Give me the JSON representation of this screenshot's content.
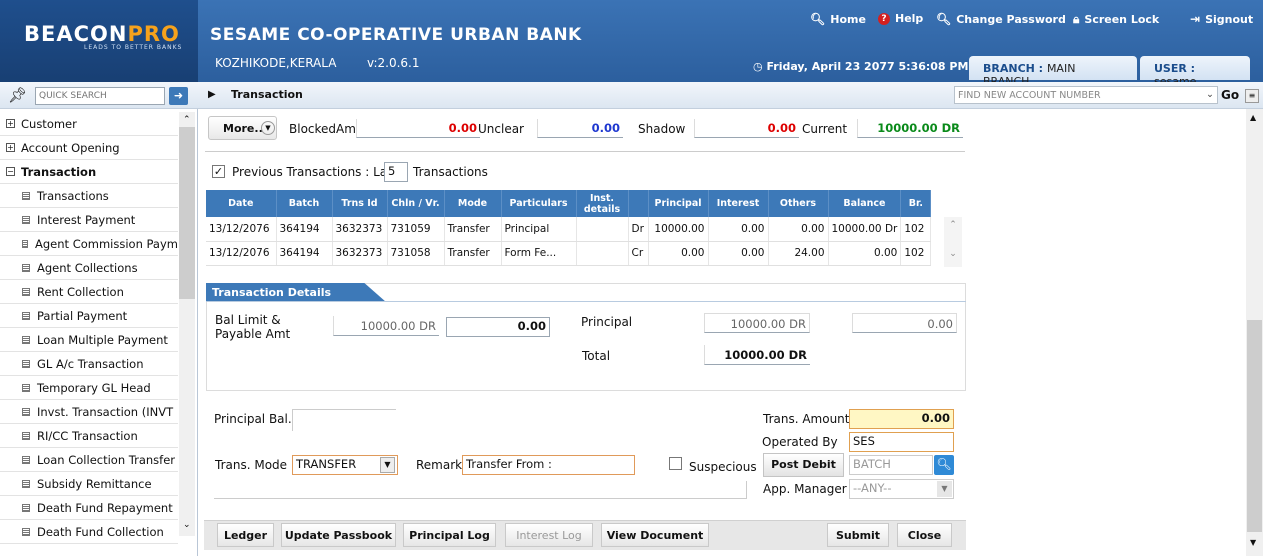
{
  "app": {
    "logo": "BEACONPRO",
    "tagline": "LEADS TO BETTER BANKS",
    "bank_name": "SESAME CO-OPERATIVE URBAN BANK",
    "location": "KOZHIKODE,KERALA",
    "version": "v:2.0.6.1",
    "datetime": "Friday, April 23 2077 5:36:08 PM"
  },
  "toplinks": {
    "home": "Home",
    "help": "Help",
    "change_password": "Change Password",
    "screen_lock": "Screen Lock",
    "signout": "Signout"
  },
  "tabs": {
    "branch_label": "BRANCH :",
    "branch_value": "MAIN BRANCH",
    "user_label": "USER :",
    "user_value": "sesame"
  },
  "search": {
    "placeholder": "QUICK SEARCH",
    "account_placeholder": "FIND NEW ACCOUNT NUMBER",
    "go": "Go"
  },
  "breadcrumb": "Transaction",
  "sidebar": {
    "items": [
      {
        "label": "Customer",
        "type": "top",
        "sign": "+"
      },
      {
        "label": "Account Opening",
        "type": "top",
        "sign": "+"
      },
      {
        "label": "Transaction",
        "type": "top",
        "sign": "−",
        "bold": true
      },
      {
        "label": "Transactions",
        "type": "child"
      },
      {
        "label": "Interest Payment",
        "type": "child"
      },
      {
        "label": "Agent Commission Paym",
        "type": "child"
      },
      {
        "label": "Agent Collections",
        "type": "child"
      },
      {
        "label": "Rent Collection",
        "type": "child"
      },
      {
        "label": "Partial Payment",
        "type": "child"
      },
      {
        "label": "Loan Multiple Payment",
        "type": "child"
      },
      {
        "label": "GL A/c Transaction",
        "type": "child"
      },
      {
        "label": "Temporary GL Head",
        "type": "child"
      },
      {
        "label": "Invst. Transaction (INVT",
        "type": "child"
      },
      {
        "label": "RI/CC Transaction",
        "type": "child"
      },
      {
        "label": "Loan Collection Transfer",
        "type": "child"
      },
      {
        "label": "Subsidy Remittance",
        "type": "child"
      },
      {
        "label": "Death Fund Repayment",
        "type": "child"
      },
      {
        "label": "Death Fund Collection",
        "type": "child"
      }
    ]
  },
  "balances": {
    "more": "More..",
    "blocked_label": "BlockedAmt",
    "blocked": "0.00",
    "unclear_label": "Unclear",
    "unclear": "0.00",
    "shadow_label": "Shadow",
    "shadow": "0.00",
    "current_label": "Current",
    "current": "10000.00 DR"
  },
  "prev_tx": {
    "label": "Previous Transactions : Last",
    "count": "5",
    "suffix": "Transactions"
  },
  "table": {
    "headers": [
      "Date",
      "Batch",
      "Trns Id",
      "Chln / Vr.",
      "Mode",
      "Particulars",
      "Inst. details",
      "",
      "Principal",
      "Interest",
      "Others",
      "Balance",
      "Br."
    ],
    "rows": [
      [
        "13/12/2076",
        "364194",
        "3632373",
        "731059",
        "Transfer",
        "Principal",
        "",
        "Dr",
        "10000.00",
        "0.00",
        "0.00",
        "10000.00 Dr",
        "102"
      ],
      [
        "13/12/2076",
        "364194",
        "3632373",
        "731058",
        "Transfer",
        "Form Fe...",
        "",
        "Cr",
        "0.00",
        "0.00",
        "24.00",
        "0.00",
        "102"
      ]
    ]
  },
  "details": {
    "title": "Transaction Details",
    "bal_limit_label": "Bal Limit & Payable Amt",
    "bal_limit": "10000.00 DR",
    "payable": "0.00",
    "principal_label": "Principal",
    "principal": "10000.00 DR",
    "principal_amt": "0.00",
    "total_label": "Total",
    "total": "10000.00 DR"
  },
  "form": {
    "principal_bal_label": "Principal Bal.",
    "trans_mode_label": "Trans. Mode",
    "trans_mode": "TRANSFER",
    "remark_label": "Remark",
    "remark": "Transfer From :",
    "suspecious_label": "Suspecious",
    "trans_amount_label": "Trans. Amount",
    "trans_amount": "0.00",
    "operated_by_label": "Operated By",
    "operated_by": "SES",
    "post_debit": "Post Debit",
    "batch_placeholder": "BATCH",
    "app_manager_label": "App. Manager",
    "app_manager": "--ANY--"
  },
  "buttons": {
    "ledger": "Ledger",
    "update_passbook": "Update Passbook",
    "principal_log": "Principal Log",
    "interest_log": "Interest Log",
    "view_document": "View Document",
    "submit": "Submit",
    "close": "Close"
  }
}
